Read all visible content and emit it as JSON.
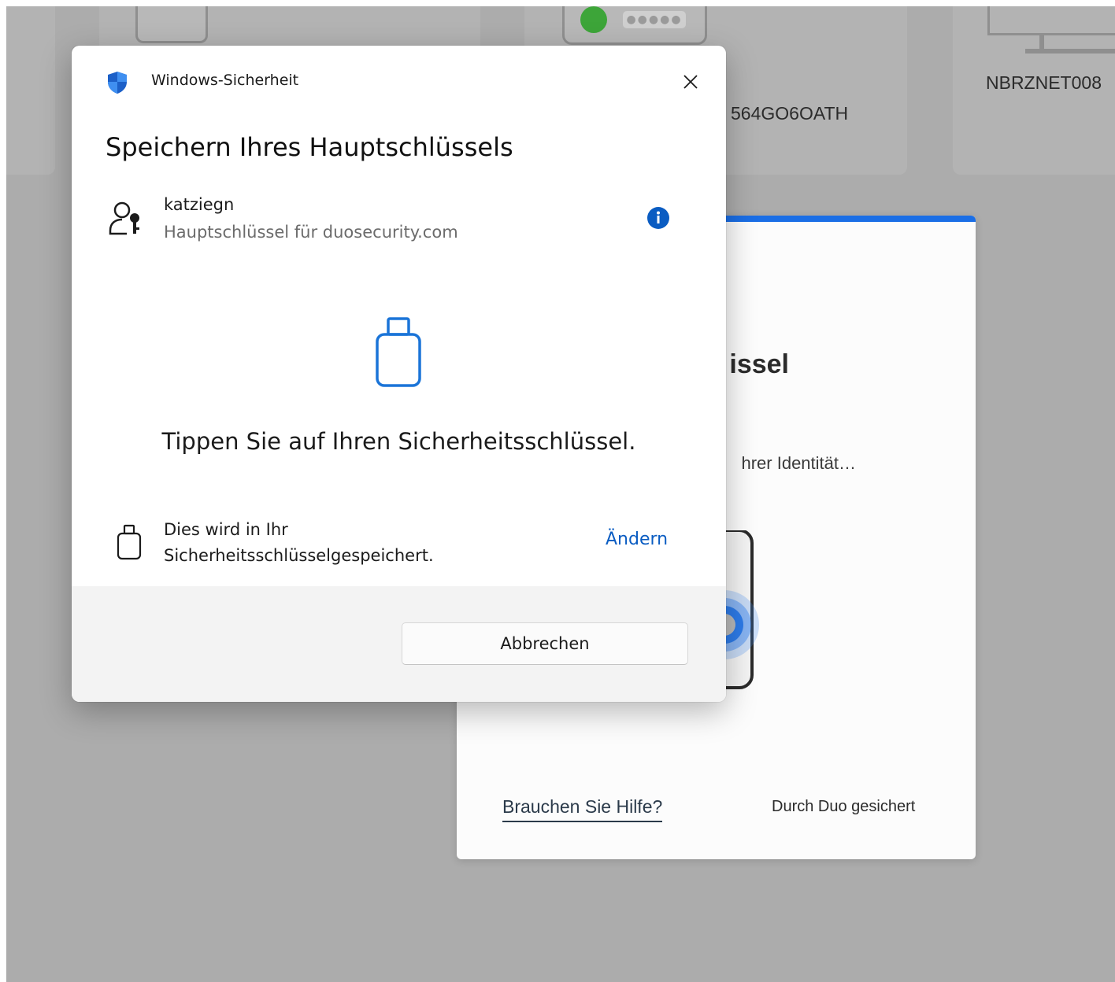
{
  "background": {
    "card_labels": [
      "NBRZNET008",
      "564GO6OATH"
    ]
  },
  "duo": {
    "heading_fragment": "issel",
    "status_fragment": "hrer Identität…",
    "help_link": "Brauchen Sie Hilfe?",
    "secured_by": "Durch Duo gesichert",
    "accent_color": "#1a6ee6"
  },
  "dialog": {
    "app_title": "Windows-Sicherheit",
    "heading": "Speichern Ihres Hauptschlüssels",
    "account": {
      "name": "katziegn",
      "subtitle": "Hauptschlüssel für duosecurity.com"
    },
    "instruction": "Tippen Sie auf Ihren Sicherheitsschlüssel.",
    "storage": {
      "line1": "Dies wird in Ihr",
      "line2": "Sicherheitsschlüsselgespeichert.",
      "change_link": "Ändern"
    },
    "cancel_label": "Abbrechen",
    "icons": {
      "shield": "shield-icon",
      "close": "close-icon",
      "account": "user-key-icon",
      "info": "info-icon",
      "security_key": "usb-key-icon"
    },
    "accent_color": "#0a5cc2"
  }
}
